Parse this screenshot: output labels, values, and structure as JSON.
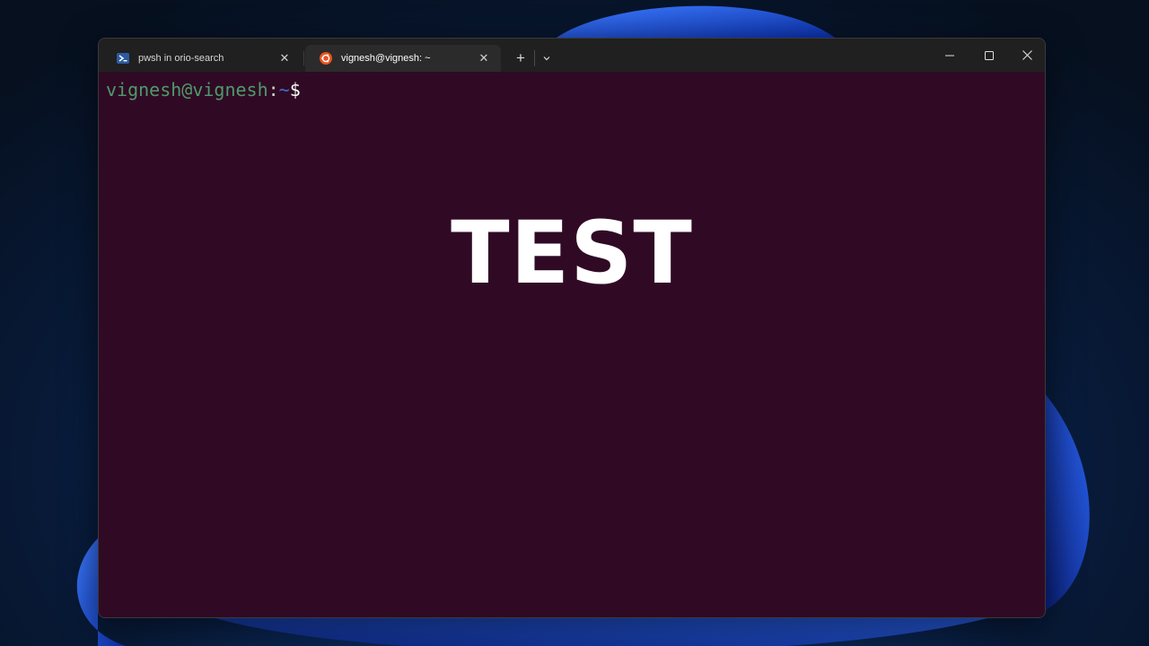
{
  "tabs": [
    {
      "title": "pwsh in orio-search",
      "icon": "powershell-icon",
      "active": false
    },
    {
      "title": "vignesh@vignesh: ~",
      "icon": "ubuntu-icon",
      "active": true
    }
  ],
  "tab_close_glyph": "✕",
  "new_tab_glyph": "+",
  "terminal": {
    "prompt_user": "vignesh@vignesh",
    "prompt_colon": ":",
    "prompt_path": "~",
    "prompt_dollar": "$"
  },
  "overlay_text": "TEST",
  "colors": {
    "terminal_bg": "#300a24",
    "titlebar_bg": "#202020",
    "active_tab_bg": "#2b2b2b",
    "prompt_user": "#4e9a6b",
    "prompt_path": "#3b6fd4",
    "ubuntu_orange": "#e95420",
    "powershell_blue": "#2c5aa0"
  }
}
